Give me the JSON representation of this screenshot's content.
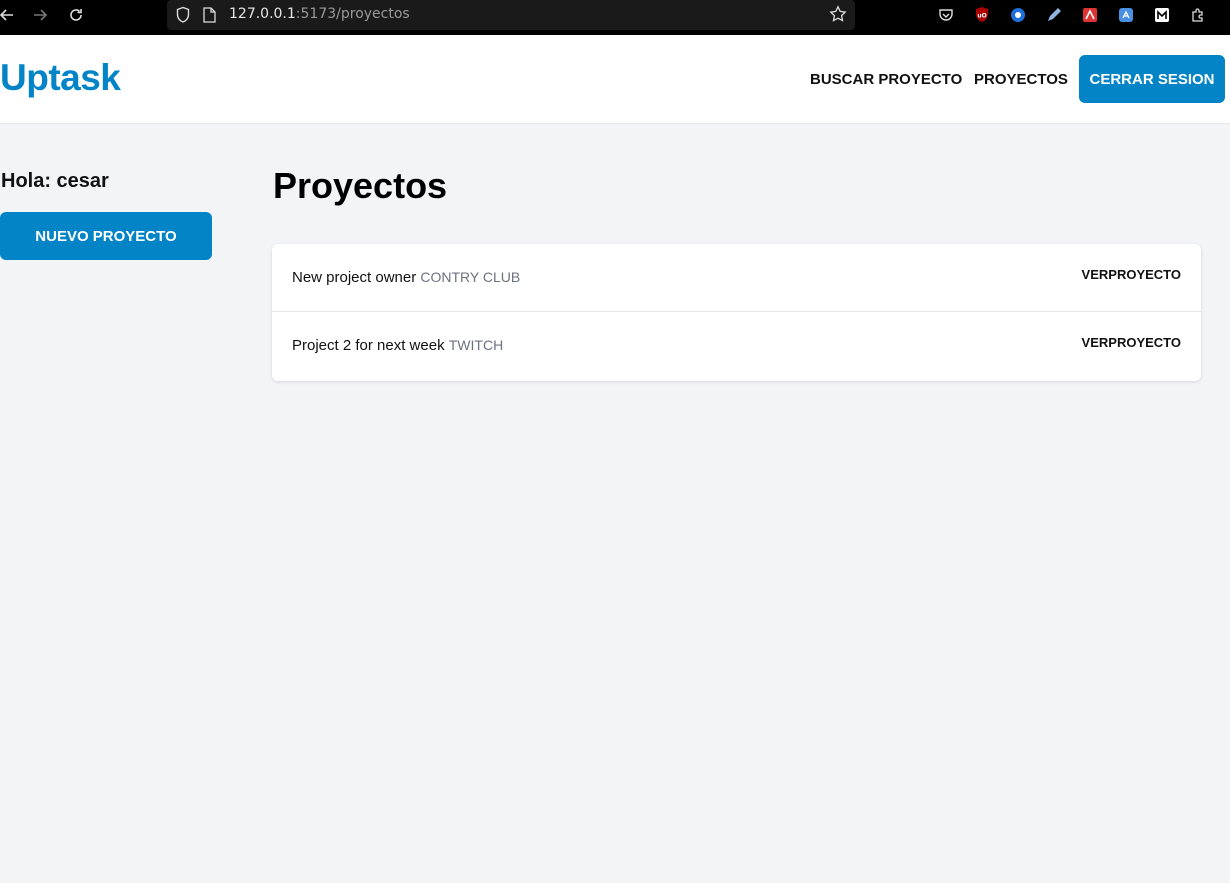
{
  "browser": {
    "url_host": "127.0.0.1",
    "url_rest": ":5173/proyectos"
  },
  "header": {
    "logo": "Uptask",
    "nav": {
      "search": "BUSCAR PROYECTO",
      "projects": "PROYECTOS"
    },
    "logout": "CERRAR SESION"
  },
  "sidebar": {
    "greeting": "Hola: cesar",
    "new_project": "NUEVO PROYECTO"
  },
  "main": {
    "title": "Proyectos",
    "projects": [
      {
        "name": "New project owner",
        "client": "CONTRY CLUB",
        "link": "VERPROYECTO"
      },
      {
        "name": "Project 2 for next week",
        "client": "TWITCH",
        "link": "VERPROYECTO"
      }
    ]
  },
  "colors": {
    "brand": "#0284c7",
    "background": "#f3f4f6"
  }
}
